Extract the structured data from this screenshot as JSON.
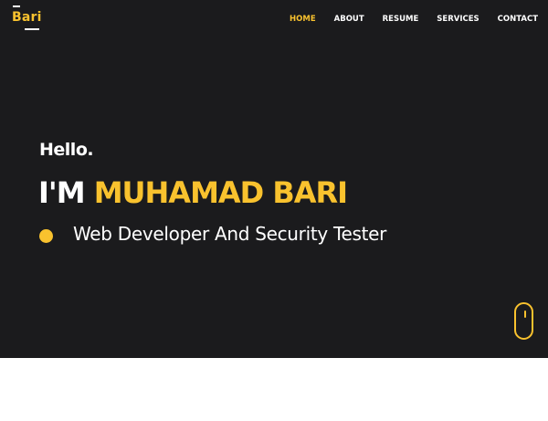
{
  "brand": {
    "logo_text": "Bari",
    "accent_color": "#f9c22e",
    "background_color": "#1b1b1d"
  },
  "nav": {
    "items": [
      {
        "label": "HOME",
        "active": true
      },
      {
        "label": "ABOUT",
        "active": false
      },
      {
        "label": "RESUME",
        "active": false
      },
      {
        "label": "SERVICES",
        "active": false
      },
      {
        "label": "CONTACT",
        "active": false
      }
    ]
  },
  "hero": {
    "greeting": "Hello.",
    "name_prefix": "I'M ",
    "name": "MUHAMAD BARI",
    "tagline": "Web Developer And Security Tester",
    "scroll_icon": "mouse-icon"
  }
}
